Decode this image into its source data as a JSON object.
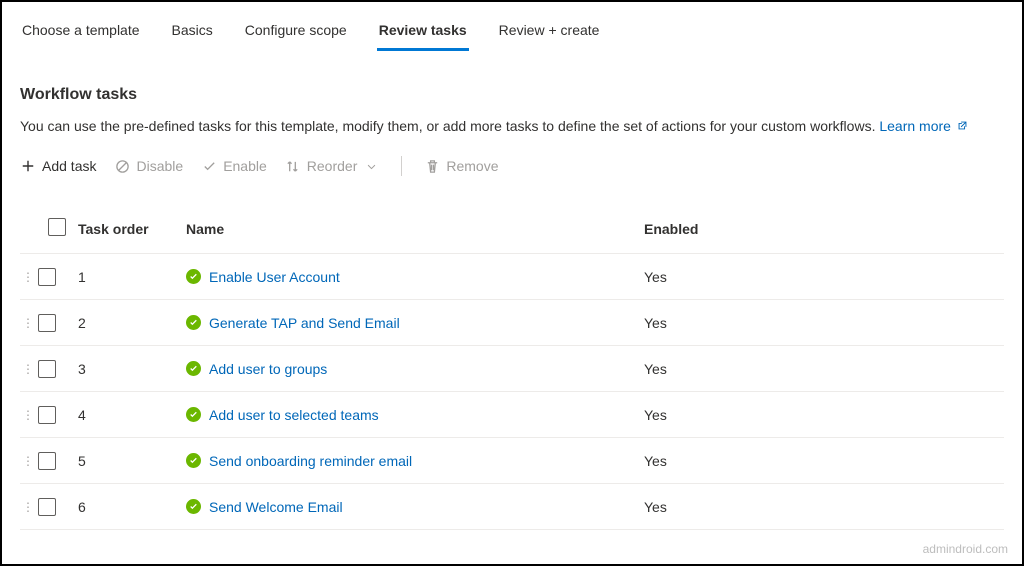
{
  "tabs": [
    {
      "label": "Choose a template",
      "active": false
    },
    {
      "label": "Basics",
      "active": false
    },
    {
      "label": "Configure scope",
      "active": false
    },
    {
      "label": "Review tasks",
      "active": true
    },
    {
      "label": "Review + create",
      "active": false
    }
  ],
  "page_title": "Workflow tasks",
  "description_text": "You can use the pre-defined tasks for this template, modify them, or add more tasks to define the set of actions for your custom workflows. ",
  "learn_more_label": "Learn more",
  "toolbar": {
    "add_task": "Add task",
    "disable": "Disable",
    "enable": "Enable",
    "reorder": "Reorder",
    "remove": "Remove"
  },
  "columns": {
    "task_order": "Task order",
    "name": "Name",
    "enabled": "Enabled"
  },
  "tasks": [
    {
      "order": "1",
      "name": "Enable User Account",
      "enabled": "Yes"
    },
    {
      "order": "2",
      "name": "Generate TAP and Send Email",
      "enabled": "Yes"
    },
    {
      "order": "3",
      "name": "Add user to groups",
      "enabled": "Yes"
    },
    {
      "order": "4",
      "name": "Add user to selected teams",
      "enabled": "Yes"
    },
    {
      "order": "5",
      "name": "Send onboarding reminder email",
      "enabled": "Yes"
    },
    {
      "order": "6",
      "name": "Send Welcome Email",
      "enabled": "Yes"
    }
  ],
  "watermark": "admindroid.com"
}
